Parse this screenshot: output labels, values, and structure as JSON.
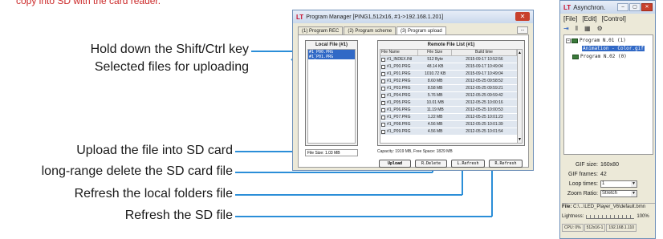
{
  "top_caption": "copy into SD with the card reader.",
  "annotations": {
    "hold_key": "Hold down the Shift/Ctrl key",
    "selected_files": "Selected files for uploading",
    "upload": "Upload the file into SD card",
    "delete": "long-range delete the SD card file",
    "refresh_local": "Refresh the local folders file",
    "refresh_sd": "Refresh the SD file"
  },
  "colors": {
    "annotation_line": "#2b8ed8",
    "selection": "#3169c6",
    "caption_red": "#cc2a2a"
  },
  "program_manager": {
    "logo": "LT",
    "title": "Program Manager  [PING1,512x16, #1->192.168.1.201]",
    "close_icon": "close-icon",
    "tabs": [
      "(1) Program REC",
      "(2) Program scheme",
      "(3) Program upload"
    ],
    "tab_more": "...",
    "local_header": "Local File (#1)",
    "local_files": [
      "#1_P00.PRG",
      "#1_P01.PRG"
    ],
    "file_size": "File Size: 1.03 MB",
    "remote_header": "Remote File List (#1)",
    "columns": [
      "File Name",
      "File Size",
      "Build time"
    ],
    "rows": [
      [
        "#1_INDEX.INI",
        "512 Byte",
        "2015-09-17 10:52:56"
      ],
      [
        "#1_P00.PRG",
        "48.14 KB",
        "2015-09-17 10:49:04"
      ],
      [
        "#1_P01.PRG",
        "1010.72 KB",
        "2015-09-17 10:49:04"
      ],
      [
        "#1_P02.PRG",
        "8.60 MB",
        "2012-05-25 09:58:52"
      ],
      [
        "#1_P03.PRG",
        "8.58 MB",
        "2012-05-25 09:59:21"
      ],
      [
        "#1_P04.PRG",
        "5.76 MB",
        "2012-05-25 09:59:42"
      ],
      [
        "#1_P05.PRG",
        "10.01 MB",
        "2012-05-25 10:00:16"
      ],
      [
        "#1_P06.PRG",
        "11.19 MB",
        "2012-05-25 10:00:53"
      ],
      [
        "#1_P07.PRG",
        "1.22 MB",
        "2012-05-25 10:01:23"
      ],
      [
        "#1_P08.PRG",
        "4.56 MB",
        "2012-05-25 10:01:39"
      ],
      [
        "#1_P09.PRG",
        "4.56 MB",
        "2012-05-25 10:01:54"
      ]
    ],
    "capacity": "Capacity:  1919 MB,   Free Space:  1829 MB",
    "buttons": {
      "upload": "Upload",
      "delete": "R.Delete",
      "l_refresh": "L.Refresh",
      "r_refresh": "R.Refresh"
    }
  },
  "asynchron": {
    "logo": "LT",
    "title": "Asynchron.",
    "menu": [
      "[File]",
      "[Edit]",
      "[Control]"
    ],
    "toolbar": [
      "play-icon",
      "pause-icon",
      "grid-icon",
      "settings-icon"
    ],
    "tree": {
      "program1": "Program N.01 (1)",
      "item": "Animation - Color.gif",
      "program2": "Program N.02 (0)"
    },
    "form": {
      "gif_size_label": "GIF size:",
      "gif_size_value": "160x80",
      "gif_frames_label": "GIF frames:",
      "gif_frames_value": "42",
      "loop_label": "Loop times:",
      "loop_value": "1",
      "zoom_label": "Zoom Ratio:",
      "zoom_value": "Stretch"
    },
    "file_label": "File:",
    "file_path": "C:\\...\\LED_Player_V6\\default.bmn",
    "lightness_label": "Lightness:",
    "lightness_value": "100%",
    "status": [
      "CPU: 0%",
      "512x16-1",
      "192.168.1.110"
    ]
  }
}
